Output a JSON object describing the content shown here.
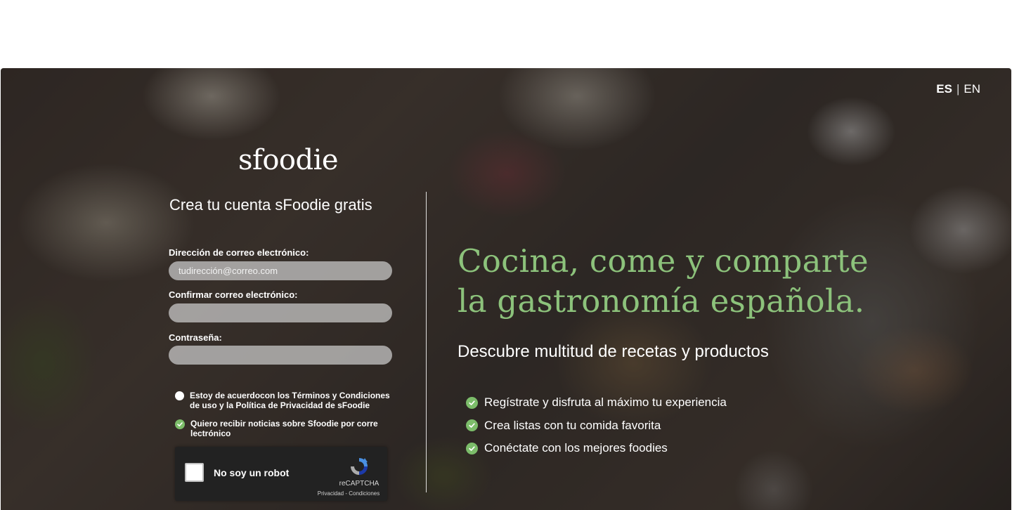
{
  "language": {
    "active": "ES",
    "separator": "|",
    "other": "EN"
  },
  "brand": {
    "logo_text": "sfoodie"
  },
  "signup": {
    "title": "Crea tu cuenta sFoodie gratis",
    "email_label": "Dirección de correo electrónico:",
    "email_placeholder": "tudirección@correo.com",
    "email_value": "",
    "confirm_label": "Confirmar correo electrónico:",
    "confirm_value": "",
    "password_label": "Contraseña:",
    "password_value": "",
    "terms_text": "Estoy de acuerdocon los Términos y Condiciones de uso y la Política de Privacidad de sFoodie",
    "terms_checked": false,
    "newsletter_text": "Quiero recibir noticias sobre Sfoodie por corre lectrónico",
    "newsletter_checked": true
  },
  "captcha": {
    "label": "No soy un robot",
    "brand": "reCAPTCHA",
    "links": "Privacidad - Condiciones"
  },
  "hero": {
    "headline_line1": "Cocina, come y comparte",
    "headline_line2": "la gastronomía española.",
    "tagline": "Descubre multitud de recetas y productos",
    "benefits": [
      "Regístrate y disfruta al máximo tu experiencia",
      "Crea listas con tu comida favorita",
      "Conéctate con los mejores foodies"
    ]
  },
  "colors": {
    "accent_green": "#8cc27b",
    "check_green": "#7cbd6a"
  },
  "icons": {
    "check": "check-circle-icon",
    "recaptcha": "recaptcha-logo-icon"
  }
}
